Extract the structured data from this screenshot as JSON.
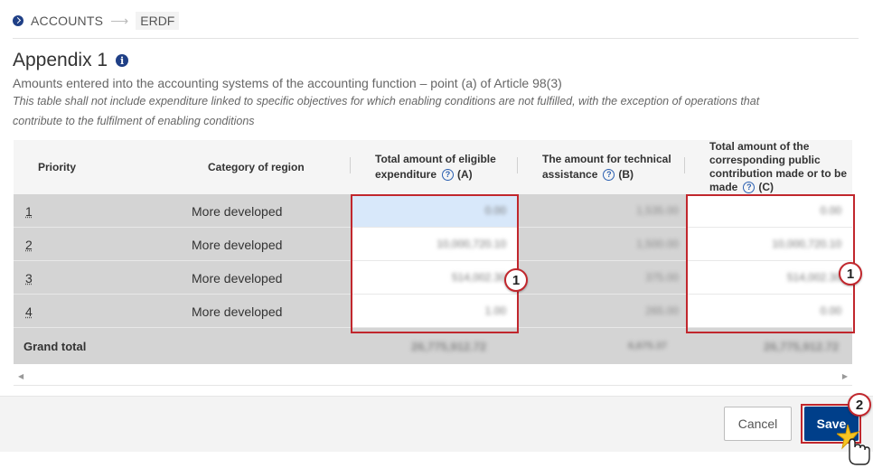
{
  "breadcrumb": {
    "root": "ACCOUNTS",
    "separator": "⟶",
    "current": "ERDF"
  },
  "page": {
    "title": "Appendix 1",
    "subtitle": "Amounts entered into the accounting systems of the accounting function – point (a) of Article 98(3)",
    "note": "This table shall not include expenditure linked to specific objectives for which enabling conditions are not fulfilled, with the exception of operations that contribute to the fulfilment of enabling conditions"
  },
  "table": {
    "headers": {
      "priority": "Priority",
      "region": "Category of region",
      "eligible_1": "Total amount of eligible",
      "eligible_2": "expenditure",
      "eligible_suffix": "(A)",
      "technical_1": "The amount for technical",
      "technical_2": "assistance",
      "technical_suffix": "(B)",
      "public_1": "Total amount of the",
      "public_2": "corresponding public",
      "public_3": "contribution made or to be",
      "public_4": "made",
      "public_suffix": "(C)"
    },
    "rows": [
      {
        "priority": "1",
        "region": "More developed",
        "a": "0.00",
        "b": "1,535.00",
        "c": "0.00"
      },
      {
        "priority": "2",
        "region": "More developed",
        "a": "10,000,720.10",
        "b": "1,500.00",
        "c": "10,000,720.10"
      },
      {
        "priority": "3",
        "region": "More developed",
        "a": "514,002.30",
        "b": "375.00",
        "c": "514,002.30"
      },
      {
        "priority": "4",
        "region": "More developed",
        "a": "1.00",
        "b": "265.00",
        "c": "0.00"
      }
    ],
    "total": {
      "label": "Grand total",
      "a": "26,775,912.72",
      "b": "6,675.37",
      "c": "26,775,912.72"
    }
  },
  "callouts": {
    "one": "1",
    "two": "2"
  },
  "footer": {
    "cancel_label": "Cancel",
    "save_label": "Save"
  },
  "colors": {
    "primary": "#003f8a",
    "highlight": "#c1272d",
    "row_bg": "#d4d4d4"
  }
}
